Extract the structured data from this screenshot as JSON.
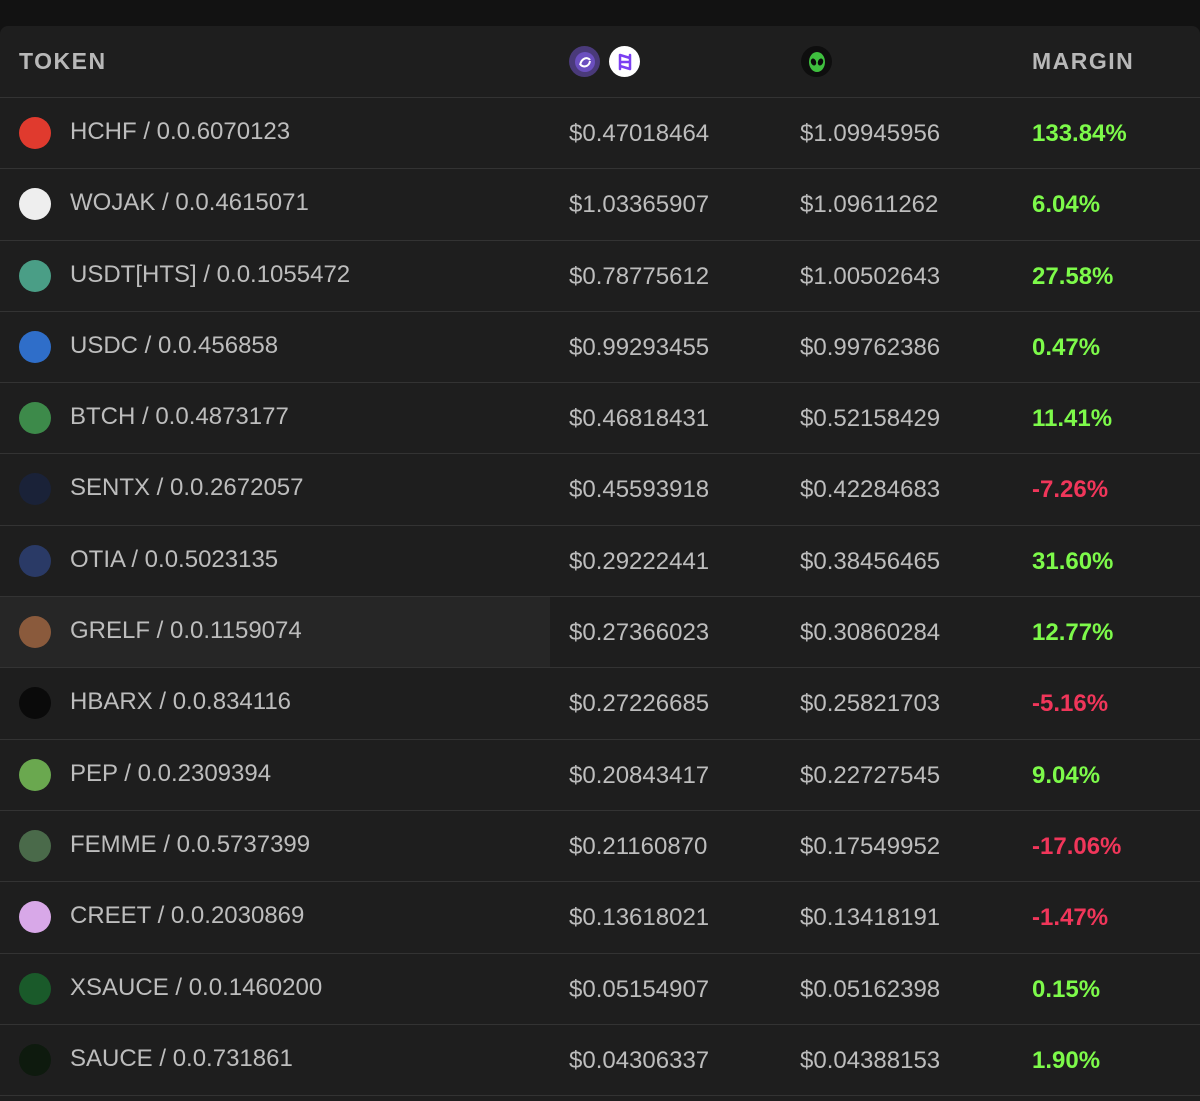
{
  "header": {
    "token_label": "TOKEN",
    "margin_label": "MARGIN",
    "source_icons": [
      "saucerswap-icon",
      "heliswap-icon",
      "alien-icon"
    ]
  },
  "colors": {
    "positive": "#7dfa4a",
    "negative": "#f0365a",
    "background": "#1e1e1e",
    "text": "#bdbdbd"
  },
  "rows": [
    {
      "token": "HCHF / 0.0.6070123",
      "price1": "$0.47018464",
      "price2": "$1.09945956",
      "margin": "133.84%",
      "sign": "pos",
      "icon": "hchf-logo-icon",
      "color": "#e03a2e"
    },
    {
      "token": "WOJAK / 0.0.4615071",
      "price1": "$1.03365907",
      "price2": "$1.09611262",
      "margin": "6.04%",
      "sign": "pos",
      "icon": "wojak-logo-icon",
      "color": "#eeeeee"
    },
    {
      "token": "USDT[HTS] / 0.0.1055472",
      "price1": "$0.78775612",
      "price2": "$1.00502643",
      "margin": "27.58%",
      "sign": "pos",
      "icon": "tether-logo-icon",
      "color": "#4a9e86"
    },
    {
      "token": "USDC / 0.0.456858",
      "price1": "$0.99293455",
      "price2": "$0.99762386",
      "margin": "0.47%",
      "sign": "pos",
      "icon": "usdc-logo-icon",
      "color": "#2f6ec9"
    },
    {
      "token": "BTCH / 0.0.4873177",
      "price1": "$0.46818431",
      "price2": "$0.52158429",
      "margin": "11.41%",
      "sign": "pos",
      "icon": "btch-logo-icon",
      "color": "#3d8a4a"
    },
    {
      "token": "SENTX / 0.0.2672057",
      "price1": "$0.45593918",
      "price2": "$0.42284683",
      "margin": "-7.26%",
      "sign": "neg",
      "icon": "sentx-logo-icon",
      "color": "#1a2238"
    },
    {
      "token": "OTIA / 0.0.5023135",
      "price1": "$0.29222441",
      "price2": "$0.38456465",
      "margin": "31.60%",
      "sign": "pos",
      "icon": "otia-logo-icon",
      "color": "#2a3a66"
    },
    {
      "token": "GRELF / 0.0.1159074",
      "price1": "$0.27366023",
      "price2": "$0.30860284",
      "margin": "12.77%",
      "sign": "pos",
      "icon": "grelf-logo-icon",
      "color": "#8a5a3c"
    },
    {
      "token": "HBARX / 0.0.834116",
      "price1": "$0.27226685",
      "price2": "$0.25821703",
      "margin": "-5.16%",
      "sign": "neg",
      "icon": "hbarx-logo-icon",
      "color": "#0a0a0a"
    },
    {
      "token": "PEP / 0.0.2309394",
      "price1": "$0.20843417",
      "price2": "$0.22727545",
      "margin": "9.04%",
      "sign": "pos",
      "icon": "pepe-logo-icon",
      "color": "#6aa84f"
    },
    {
      "token": "FEMME / 0.0.5737399",
      "price1": "$0.21160870",
      "price2": "$0.17549952",
      "margin": "-17.06%",
      "sign": "neg",
      "icon": "femme-logo-icon",
      "color": "#4a6a4a"
    },
    {
      "token": "CREET / 0.0.2030869",
      "price1": "$0.13618021",
      "price2": "$0.13418191",
      "margin": "-1.47%",
      "sign": "neg",
      "icon": "creet-logo-icon",
      "color": "#d8a8e8"
    },
    {
      "token": "XSAUCE / 0.0.1460200",
      "price1": "$0.05154907",
      "price2": "$0.05162398",
      "margin": "0.15%",
      "sign": "pos",
      "icon": "xsauce-logo-icon",
      "color": "#1a5a2a"
    },
    {
      "token": "SAUCE / 0.0.731861",
      "price1": "$0.04306337",
      "price2": "$0.04388153",
      "margin": "1.90%",
      "sign": "pos",
      "icon": "sauce-logo-icon",
      "color": "#0e1a0e"
    }
  ]
}
